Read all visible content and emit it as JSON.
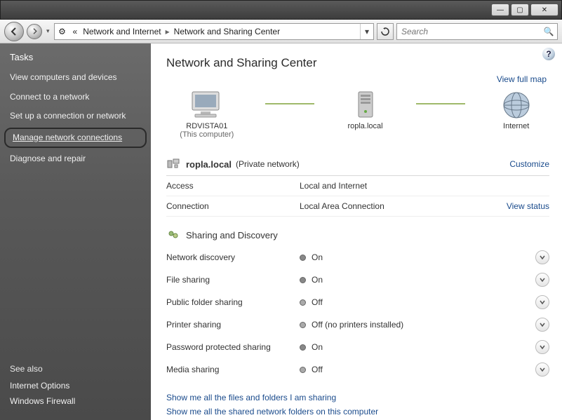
{
  "breadcrumb": {
    "seg1": "Network and Internet",
    "seg2": "Network and Sharing Center"
  },
  "search": {
    "placeholder": "Search"
  },
  "sidebar": {
    "tasks_head": "Tasks",
    "links": [
      "View computers and devices",
      "Connect to a network",
      "Set up a connection or network",
      "Manage network connections",
      "Diagnose and repair"
    ],
    "see_also_head": "See also",
    "see_also": [
      "Internet Options",
      "Windows Firewall"
    ]
  },
  "page_title": "Network and Sharing Center",
  "full_map": "View full map",
  "netmap": {
    "node1": {
      "name": "RDVISTA01",
      "sub": "(This computer)"
    },
    "node2": {
      "name": "ropla.local"
    },
    "node3": {
      "name": "Internet"
    }
  },
  "network": {
    "name": "ropla.local",
    "type": "(Private network)",
    "customize": "Customize",
    "rows": [
      {
        "label": "Access",
        "value": "Local and Internet",
        "action": ""
      },
      {
        "label": "Connection",
        "value": "Local Area Connection",
        "action": "View status"
      }
    ]
  },
  "sharing": {
    "head": "Sharing and Discovery",
    "rows": [
      {
        "label": "Network discovery",
        "value": "On",
        "on": true
      },
      {
        "label": "File sharing",
        "value": "On",
        "on": true
      },
      {
        "label": "Public folder sharing",
        "value": "Off",
        "on": false
      },
      {
        "label": "Printer sharing",
        "value": "Off (no printers installed)",
        "on": false
      },
      {
        "label": "Password protected sharing",
        "value": "On",
        "on": true
      },
      {
        "label": "Media sharing",
        "value": "Off",
        "on": false
      }
    ]
  },
  "bottom_links": [
    "Show me all the files and folders I am sharing",
    "Show me all the shared network folders on this computer"
  ]
}
